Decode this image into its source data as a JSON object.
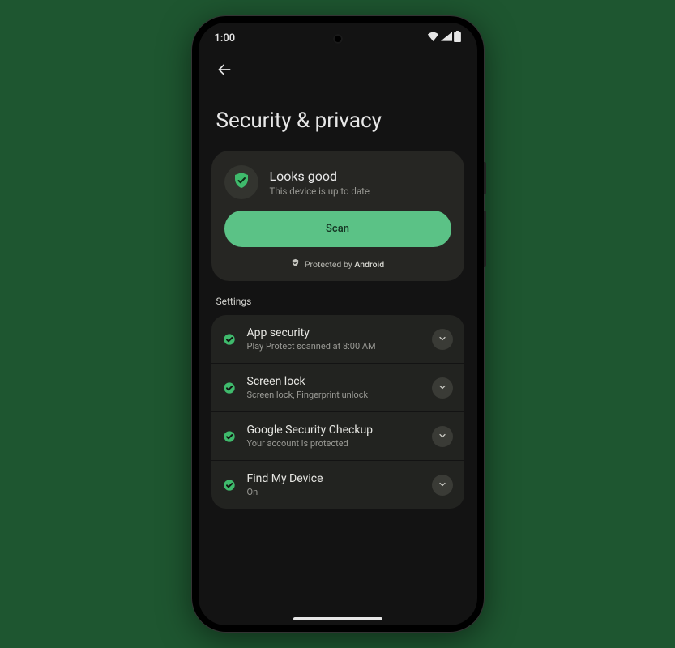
{
  "status_bar": {
    "time": "1:00"
  },
  "page": {
    "title": "Security & privacy"
  },
  "status_card": {
    "title": "Looks good",
    "subtitle": "This device is up to date",
    "scan_label": "Scan",
    "protected_prefix": "Protected by ",
    "protected_brand": "Android"
  },
  "settings": {
    "section_label": "Settings",
    "items": [
      {
        "title": "App security",
        "subtitle": "Play Protect scanned at 8:00 AM"
      },
      {
        "title": "Screen lock",
        "subtitle": "Screen lock, Fingerprint unlock"
      },
      {
        "title": "Google Security Checkup",
        "subtitle": "Your account is protected"
      },
      {
        "title": "Find My Device",
        "subtitle": "On"
      }
    ]
  },
  "colors": {
    "accent_green": "#5bc286",
    "check_green": "#3fba6c"
  }
}
